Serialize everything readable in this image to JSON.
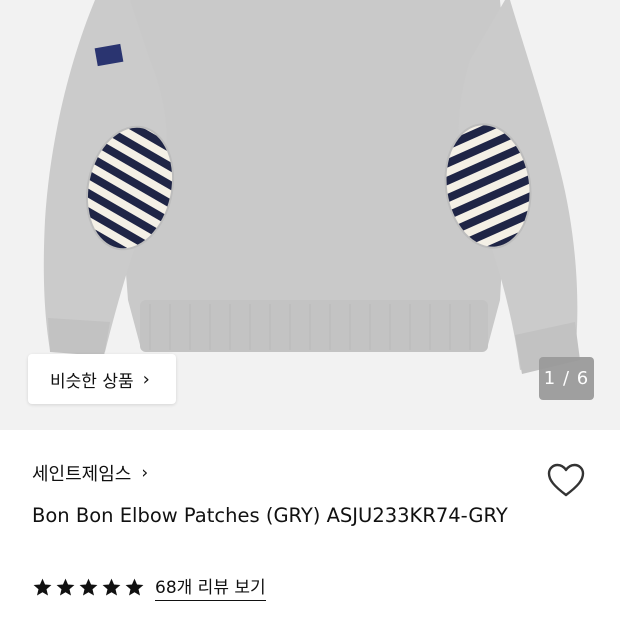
{
  "product": {
    "similar_label": "비슷한 상품",
    "similar_chevron": "›",
    "image_index": "1 / 6",
    "brand": "세인트제임스",
    "brand_chevron": "›",
    "title": "Bon Bon Elbow Patches (GRY) ASJU233KR74-GRY",
    "rating": 5,
    "rating_max": 5,
    "review_link": "68개 리뷰 보기"
  },
  "icons": {
    "wishlist": "heart-outline-icon",
    "star": "star-icon"
  },
  "colors": {
    "sweatshirt": "#c8c8c8",
    "stripe_dark": "#1f2546",
    "stripe_light": "#f4f0e6",
    "page_indicator_bg": "#999999"
  }
}
